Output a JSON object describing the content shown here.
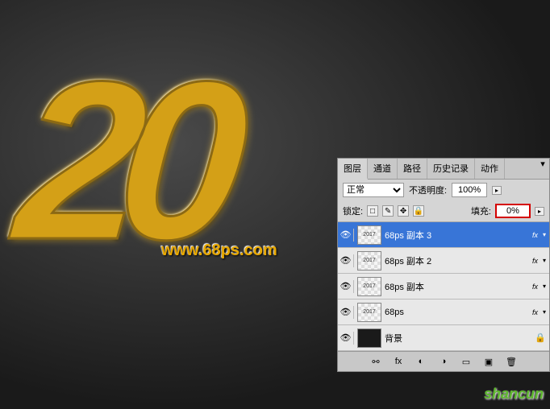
{
  "canvas": {
    "art_text": "20",
    "watermark1": "www.68ps.com",
    "watermark2": "shancun"
  },
  "panel": {
    "tabs": [
      "图层",
      "通道",
      "路径",
      "历史记录",
      "动作"
    ],
    "blend_mode": "正常",
    "opacity_label": "不透明度:",
    "opacity_value": "100%",
    "lock_label": "锁定:",
    "fill_label": "填充:",
    "fill_value": "0%",
    "layers": [
      {
        "name": "68ps 副本 3",
        "thumb": "2017",
        "fx": true,
        "selected": true,
        "bg": false
      },
      {
        "name": "68ps 副本 2",
        "thumb": "2017",
        "fx": true,
        "selected": false,
        "bg": false
      },
      {
        "name": "68ps 副本",
        "thumb": "2017",
        "fx": true,
        "selected": false,
        "bg": false
      },
      {
        "name": "68ps",
        "thumb": "2017",
        "fx": true,
        "selected": false,
        "bg": false
      },
      {
        "name": "背景",
        "thumb": "",
        "fx": false,
        "selected": false,
        "bg": true
      }
    ],
    "thumb_text": "2017"
  }
}
